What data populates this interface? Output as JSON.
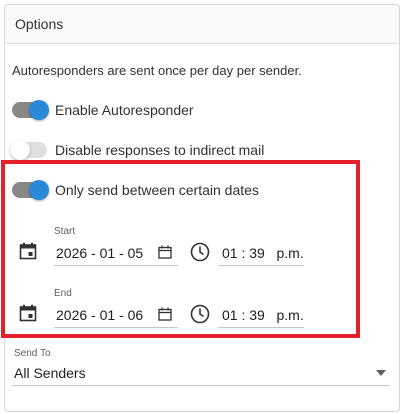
{
  "panel": {
    "title": "Options"
  },
  "info_text": "Autoresponders are sent once per day per sender.",
  "toggles": [
    {
      "label": "Enable Autoresponder",
      "state": "on"
    },
    {
      "label": "Disable responses to indirect mail",
      "state": "off"
    },
    {
      "label": "Only send between certain dates",
      "state": "on"
    }
  ],
  "start": {
    "label": "Start",
    "date": "2026 - 01 - 05",
    "time": "01 : 39   p.m."
  },
  "end": {
    "label": "End",
    "date": "2026 - 01 - 06",
    "time": "01 : 39   p.m."
  },
  "send_to": {
    "label": "Send To",
    "value": "All Senders"
  },
  "colors": {
    "toggle_on_knob": "#2b88d8",
    "highlight_border": "#e3212b"
  },
  "icons": [
    "calendar-icon",
    "clock-icon",
    "chevron-down-icon"
  ]
}
